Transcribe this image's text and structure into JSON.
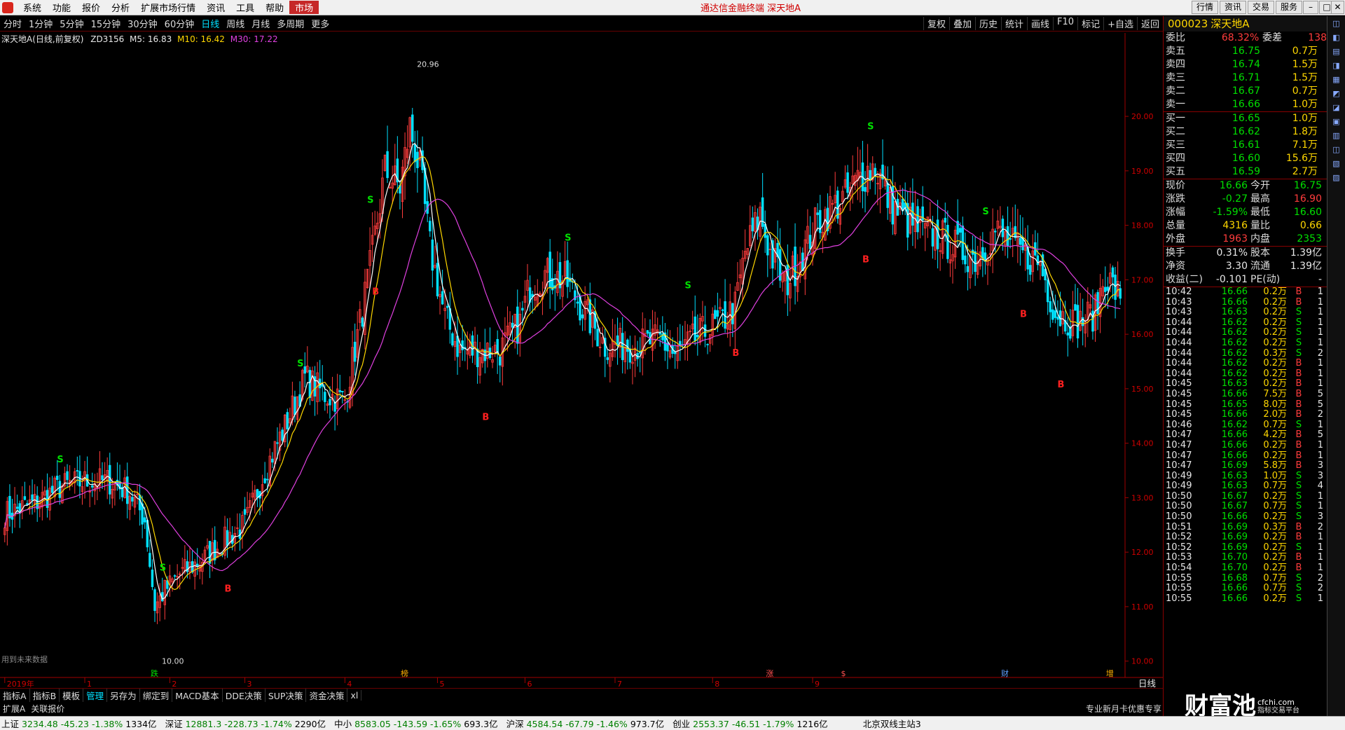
{
  "menu": {
    "items": [
      "系统",
      "功能",
      "报价",
      "分析",
      "扩展市场行情",
      "资讯",
      "工具",
      "帮助",
      "市场"
    ],
    "app_title": "通达信金融终端 深天地A",
    "right_buttons": [
      "行情",
      "资讯",
      "交易",
      "服务"
    ]
  },
  "timeframes": [
    "分时",
    "1分钟",
    "5分钟",
    "15分钟",
    "30分钟",
    "60分钟",
    "日线",
    "周线",
    "月线",
    "多周期",
    "更多"
  ],
  "active_timeframe": "日线",
  "tools": [
    "复权",
    "叠加",
    "历史",
    "统计",
    "画线",
    "F10",
    "标记",
    "+自选",
    "返回"
  ],
  "legend": {
    "name": "深天地A(日线,前复权)",
    "indicator": "ZD3156",
    "m5": "M5: 16.83",
    "m10": "M10: 16.42",
    "m30": "M30: 17.22"
  },
  "chart_data": {
    "type": "candlestick",
    "ylim": [
      10.0,
      21.0
    ],
    "y_ticks": [
      "10.00",
      "11.00",
      "12.00",
      "13.00",
      "14.00",
      "15.00",
      "16.00",
      "17.00",
      "18.00",
      "19.00",
      "20.00"
    ],
    "high_label": "20.96",
    "low_label": "10.00",
    "x_labels": [
      "2019年",
      "1",
      "2",
      "3",
      "4",
      "5",
      "6",
      "7",
      "8",
      "9"
    ],
    "signals": {
      "S": [
        15,
        42,
        79,
        98,
        151,
        183,
        232,
        263
      ],
      "B": [
        60,
        99,
        129,
        196,
        283,
        231,
        273
      ]
    },
    "events": [
      "跌",
      "榜",
      "涨",
      "$",
      "财",
      "增"
    ]
  },
  "future_note": "用到未来数据",
  "period_label": "日线",
  "side": {
    "code": "000023",
    "name": "深天地A",
    "weibi": {
      "l1": "委比",
      "v1": "68.32%",
      "l2": "委差",
      "v2": "138"
    },
    "asks": [
      {
        "l": "卖五",
        "p": "16.75",
        "v": "0.7万"
      },
      {
        "l": "卖四",
        "p": "16.74",
        "v": "1.5万"
      },
      {
        "l": "卖三",
        "p": "16.71",
        "v": "1.5万"
      },
      {
        "l": "卖二",
        "p": "16.67",
        "v": "0.7万"
      },
      {
        "l": "卖一",
        "p": "16.66",
        "v": "1.0万"
      }
    ],
    "bids": [
      {
        "l": "买一",
        "p": "16.65",
        "v": "1.0万"
      },
      {
        "l": "买二",
        "p": "16.62",
        "v": "1.8万"
      },
      {
        "l": "买三",
        "p": "16.61",
        "v": "7.1万"
      },
      {
        "l": "买四",
        "p": "16.60",
        "v": "15.6万"
      },
      {
        "l": "买五",
        "p": "16.59",
        "v": "2.7万"
      }
    ],
    "quote": [
      {
        "a": "现价",
        "b": "16.66",
        "c": "今开",
        "d": "16.75"
      },
      {
        "a": "涨跌",
        "b": "-0.27",
        "c": "最高",
        "d": "16.90"
      },
      {
        "a": "涨幅",
        "b": "-1.59%",
        "c": "最低",
        "d": "16.60"
      },
      {
        "a": "总量",
        "b": "4316",
        "c": "量比",
        "d": "0.66"
      },
      {
        "a": "外盘",
        "b": "1963",
        "c": "内盘",
        "d": "2353"
      }
    ],
    "stats": [
      {
        "a": "换手",
        "b": "0.31%",
        "c": "股本",
        "d": "1.39亿"
      },
      {
        "a": "净资",
        "b": "3.30",
        "c": "流通",
        "d": "1.39亿"
      },
      {
        "a": "收益(二)",
        "b": "-0.101",
        "c": "PE(动)",
        "d": "-"
      }
    ],
    "ticks": [
      [
        "10:42",
        "16.66",
        "0.2万",
        "B",
        "1"
      ],
      [
        "10:43",
        "16.66",
        "0.2万",
        "B",
        "1"
      ],
      [
        "10:43",
        "16.63",
        "0.2万",
        "S",
        "1"
      ],
      [
        "10:44",
        "16.62",
        "0.2万",
        "S",
        "1"
      ],
      [
        "10:44",
        "16.62",
        "0.2万",
        "S",
        "1"
      ],
      [
        "10:44",
        "16.62",
        "0.2万",
        "S",
        "1"
      ],
      [
        "10:44",
        "16.62",
        "0.3万",
        "S",
        "2"
      ],
      [
        "10:44",
        "16.62",
        "0.2万",
        "B",
        "1"
      ],
      [
        "10:44",
        "16.62",
        "0.2万",
        "B",
        "1"
      ],
      [
        "10:45",
        "16.63",
        "0.2万",
        "B",
        "1"
      ],
      [
        "10:45",
        "16.66",
        "7.5万",
        "B",
        "5"
      ],
      [
        "10:45",
        "16.65",
        "8.0万",
        "B",
        "5"
      ],
      [
        "10:45",
        "16.66",
        "2.0万",
        "B",
        "2"
      ],
      [
        "10:46",
        "16.62",
        "0.7万",
        "S",
        "1"
      ],
      [
        "10:47",
        "16.66",
        "4.2万",
        "B",
        "5"
      ],
      [
        "10:47",
        "16.66",
        "0.2万",
        "B",
        "1"
      ],
      [
        "10:47",
        "16.66",
        "0.2万",
        "B",
        "1"
      ],
      [
        "10:47",
        "16.69",
        "5.8万",
        "B",
        "3"
      ],
      [
        "10:49",
        "16.63",
        "1.0万",
        "S",
        "3"
      ],
      [
        "10:49",
        "16.63",
        "0.7万",
        "S",
        "4"
      ],
      [
        "10:50",
        "16.67",
        "0.2万",
        "S",
        "1"
      ],
      [
        "10:50",
        "16.67",
        "0.7万",
        "S",
        "1"
      ],
      [
        "10:50",
        "16.66",
        "0.2万",
        "S",
        "3"
      ],
      [
        "10:51",
        "16.69",
        "0.3万",
        "B",
        "2"
      ],
      [
        "10:52",
        "16.69",
        "0.2万",
        "B",
        "1"
      ],
      [
        "10:52",
        "16.69",
        "0.2万",
        "S",
        "1"
      ],
      [
        "10:53",
        "16.70",
        "0.2万",
        "B",
        "1"
      ],
      [
        "10:54",
        "16.70",
        "0.2万",
        "B",
        "1"
      ],
      [
        "10:55",
        "16.68",
        "0.7万",
        "S",
        "2"
      ],
      [
        "10:55",
        "16.66",
        "0.7万",
        "S",
        "2"
      ],
      [
        "10:55",
        "16.66",
        "0.2万",
        "S",
        "1"
      ]
    ]
  },
  "bottom_tabs": [
    "指标A",
    "指标B",
    "模板",
    "管理",
    "另存为",
    "绑定到",
    "MACD基本",
    "DDE决策",
    "SUP决策",
    "资金决策",
    "xl"
  ],
  "bottom_tabs2": [
    "扩展A",
    "关联报价"
  ],
  "promo": "专业新月卡优惠专享",
  "brand": "财富池",
  "brand_sub": "cfchi.com",
  "brand_sub2": "指标交易平台",
  "status": [
    {
      "n": "上证",
      "v": "3234.48",
      "c": "-45.23",
      "p": "-1.38%",
      "a": "1334亿"
    },
    {
      "n": "深证",
      "v": "12881.3",
      "c": "-228.73",
      "p": "-1.74%",
      "a": "2290亿"
    },
    {
      "n": "中小",
      "v": "8583.05",
      "c": "-143.59",
      "p": "-1.65%",
      "a": "693.3亿"
    },
    {
      "n": "沪深",
      "v": "4584.54",
      "c": "-67.79",
      "p": "-1.46%",
      "a": "973.7亿"
    },
    {
      "n": "创业",
      "v": "2553.37",
      "c": "-46.51",
      "p": "-1.79%",
      "a": "1216亿"
    }
  ],
  "server": "北京双线主站3",
  "colors": {
    "up": "#ff3c3c",
    "down": "#00e0ff",
    "m5": "#ffffff",
    "m10": "#ffd700",
    "m30": "#e040e0",
    "axis": "#a00000"
  }
}
